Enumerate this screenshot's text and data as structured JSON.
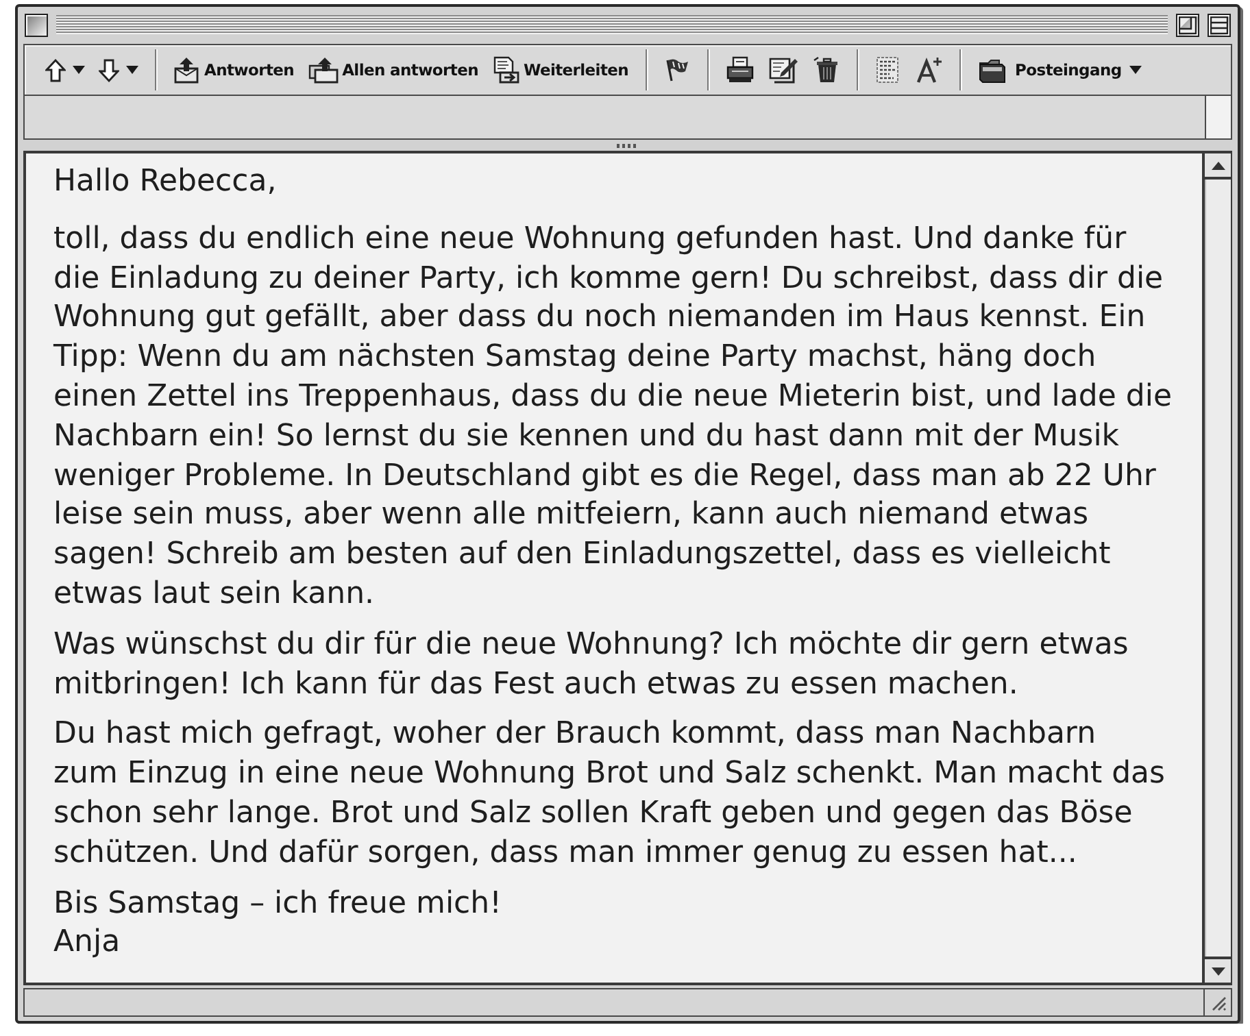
{
  "toolbar": {
    "buttons": [
      {
        "label": "Antworten"
      },
      {
        "label": "Allen antworten"
      },
      {
        "label": "Weiterleiten"
      }
    ],
    "mailbox": {
      "label": "Posteingang"
    }
  },
  "message": {
    "paragraphs": [
      {
        "kind": "greeting",
        "lines": [
          "Hallo Rebecca,"
        ]
      },
      {
        "kind": "body",
        "lines": [
          "toll, dass du endlich eine neue Wohnung gefunden hast. Und danke für",
          "die Einladung zu deiner Party, ich komme gern! Du schreibst, dass dir die",
          "Wohnung gut gefällt, aber dass du noch niemanden im Haus kennst. Ein",
          "Tipp: Wenn du am nächsten Samstag deine Party machst, häng doch",
          "einen Zettel ins Treppenhaus, dass du die neue Mieterin bist, und lade die",
          "Nachbarn ein! So lernst du sie kennen und du hast dann mit der Musik",
          "weniger Probleme. In Deutschland gibt es die Regel, dass man ab 22 Uhr",
          "leise sein muss, aber wenn alle mitfeiern, kann auch niemand etwas",
          "sagen! Schreib am besten auf den Einladungszettel, dass es vielleicht",
          "etwas laut sein kann."
        ]
      },
      {
        "kind": "body",
        "lines": [
          "Was wünschst du dir für die neue Wohnung? Ich möchte dir gern etwas",
          "mitbringen! Ich kann für das Fest auch etwas zu essen machen."
        ]
      },
      {
        "kind": "body",
        "lines": [
          "Du hast mich gefragt, woher der Brauch kommt, dass man Nachbarn",
          "zum Einzug in eine neue Wohnung Brot und Salz schenkt. Man macht das",
          "schon sehr lange. Brot und Salz sollen Kraft geben und gegen das Böse",
          "schützen. Und dafür sorgen, dass man immer genug zu essen hat..."
        ]
      },
      {
        "kind": "closing",
        "lines": [
          "Bis Samstag – ich freue mich!",
          "Anja"
        ]
      }
    ]
  }
}
